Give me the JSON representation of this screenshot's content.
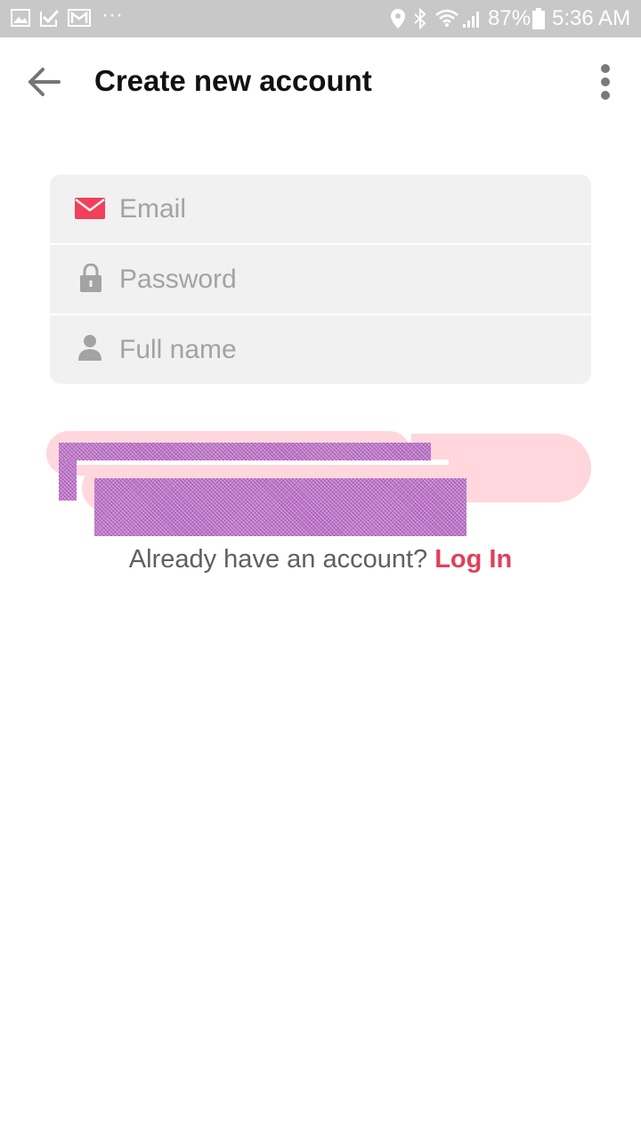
{
  "status_bar": {
    "battery": "87%",
    "time": "5:36 AM",
    "more": "···",
    "left_icons": [
      "gallery-icon",
      "check-icon",
      "gmail-icon"
    ],
    "right_icons": [
      "location-icon",
      "bluetooth-icon",
      "wifi-icon",
      "signal-icon",
      "battery-icon"
    ]
  },
  "app_bar": {
    "title": "Create new account",
    "back_icon": "arrow-back-icon",
    "menu_icon": "more-vert-icon"
  },
  "form": {
    "email": {
      "placeholder": "Email",
      "value": "",
      "icon": "mail-icon",
      "icon_color": "#f0405a"
    },
    "password": {
      "placeholder": "Password",
      "value": "",
      "icon": "lock-icon"
    },
    "full_name": {
      "placeholder": "Full name",
      "value": "",
      "icon": "person-icon"
    }
  },
  "login_prompt": {
    "text": "Already have an account?",
    "link": "Log In"
  },
  "colors": {
    "accent": "#e0405a",
    "status_bar": "#c8c8c8",
    "field_bg": "#f1f1f1",
    "button_bg": "#ffd7dc"
  }
}
